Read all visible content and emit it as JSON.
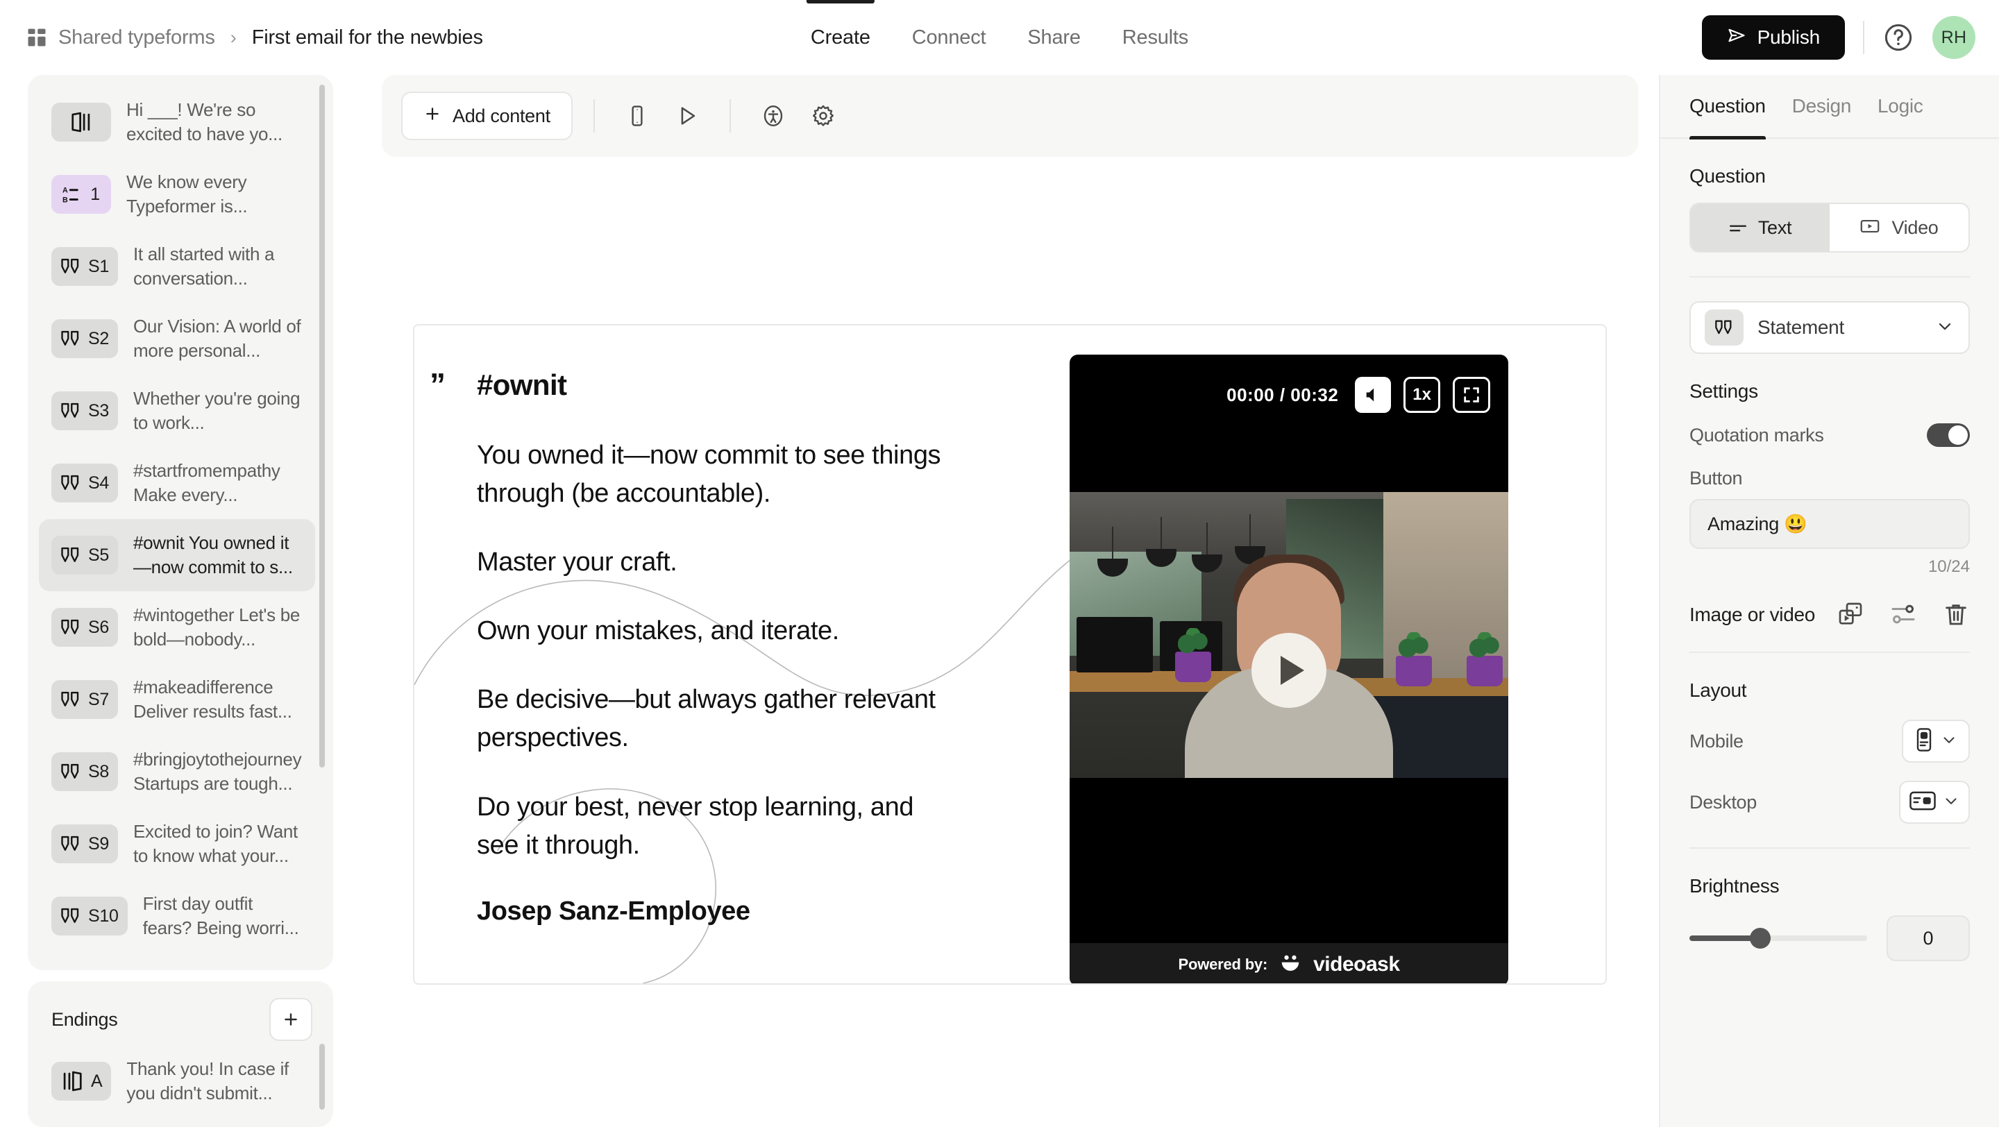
{
  "header": {
    "breadcrumb_root": "Shared typeforms",
    "breadcrumb_sep": "›",
    "breadcrumb_current": "First email for the newbies",
    "nav_tabs": [
      {
        "label": "Create",
        "active": true
      },
      {
        "label": "Connect",
        "active": false
      },
      {
        "label": "Share",
        "active": false
      },
      {
        "label": "Results",
        "active": false
      }
    ],
    "publish_label": "Publish",
    "avatar_initials": "RH"
  },
  "sidebar": {
    "questions": [
      {
        "badge": "",
        "label": "Hi ___! We're so excited to have yo...",
        "icon": "slide-icon",
        "purple": false,
        "selected": false
      },
      {
        "badge": "1",
        "label": "We know every Typeformer is...",
        "icon": "choice-icon",
        "purple": true,
        "selected": false
      },
      {
        "badge": "S1",
        "label": "It all started with a conversation...",
        "icon": "quote-icon",
        "purple": false,
        "selected": false
      },
      {
        "badge": "S2",
        "label": "Our Vision: A world of more personal...",
        "icon": "quote-icon",
        "purple": false,
        "selected": false
      },
      {
        "badge": "S3",
        "label": "Whether you're going to work...",
        "icon": "quote-icon",
        "purple": false,
        "selected": false
      },
      {
        "badge": "S4",
        "label": "#startfromempathy Make every...",
        "icon": "quote-icon",
        "purple": false,
        "selected": false
      },
      {
        "badge": "S5",
        "label": "#ownit You owned it—now commit to s...",
        "icon": "quote-icon",
        "purple": false,
        "selected": true
      },
      {
        "badge": "S6",
        "label": "#wintogether Let's be bold—nobody...",
        "icon": "quote-icon",
        "purple": false,
        "selected": false
      },
      {
        "badge": "S7",
        "label": "#makeadifference Deliver results fast...",
        "icon": "quote-icon",
        "purple": false,
        "selected": false
      },
      {
        "badge": "S8",
        "label": "#bringjoytothejourney Startups are tough...",
        "icon": "quote-icon",
        "purple": false,
        "selected": false
      },
      {
        "badge": "S9",
        "label": "Excited to join? Want to know what your...",
        "icon": "quote-icon",
        "purple": false,
        "selected": false
      },
      {
        "badge": "S10",
        "label": "First day outfit fears? Being worri...",
        "icon": "quote-icon",
        "purple": false,
        "selected": false
      }
    ],
    "endings_title": "Endings",
    "endings": [
      {
        "badge": "A",
        "label": "Thank you! In case if you didn't submit...",
        "icon": "ending-icon"
      }
    ]
  },
  "toolbar": {
    "add_content_label": "Add content",
    "icons": [
      "mobile-preview-icon",
      "play-preview-icon",
      "accessibility-icon",
      "settings-gear-icon"
    ]
  },
  "slide": {
    "title": "#ownit",
    "paragraphs": [
      "You owned it—now commit to see things through (be accountable).",
      "Master your craft.",
      "Own your mistakes, and iterate.",
      "Be decisive—but always gather relevant perspectives.",
      "Do your best, never stop learning, and see it through."
    ],
    "author": "Josep Sanz-Employee"
  },
  "video": {
    "time_current": "00:00",
    "time_total": "00:32",
    "time_display": "00:00 / 00:32",
    "speed_label": "1x",
    "powered_by_label": "Powered by:",
    "brand": "videoask"
  },
  "rightpanel": {
    "tabs": [
      {
        "label": "Question",
        "active": true
      },
      {
        "label": "Design",
        "active": false
      },
      {
        "label": "Logic",
        "active": false
      }
    ],
    "question_section_title": "Question",
    "mode_text": "Text",
    "mode_video": "Video",
    "type_label": "Statement",
    "settings_title": "Settings",
    "quotation_marks_label": "Quotation marks",
    "quotation_marks_on": true,
    "button_label": "Button",
    "button_value": "Amazing 😃",
    "button_counter": "10/24",
    "media_label": "Image or video",
    "media_icons": [
      "replace-media-icon",
      "adjust-media-icon",
      "delete-media-icon"
    ],
    "layout_title": "Layout",
    "mobile_label": "Mobile",
    "desktop_label": "Desktop",
    "brightness_label": "Brightness",
    "brightness_value": "0",
    "brightness_percent": 40
  },
  "colors": {
    "accent_dark": "#0c0c0c",
    "avatar_green": "#aee3b6",
    "badge_purple": "#e6d5f2",
    "panel_bg": "#f7f7f6"
  }
}
